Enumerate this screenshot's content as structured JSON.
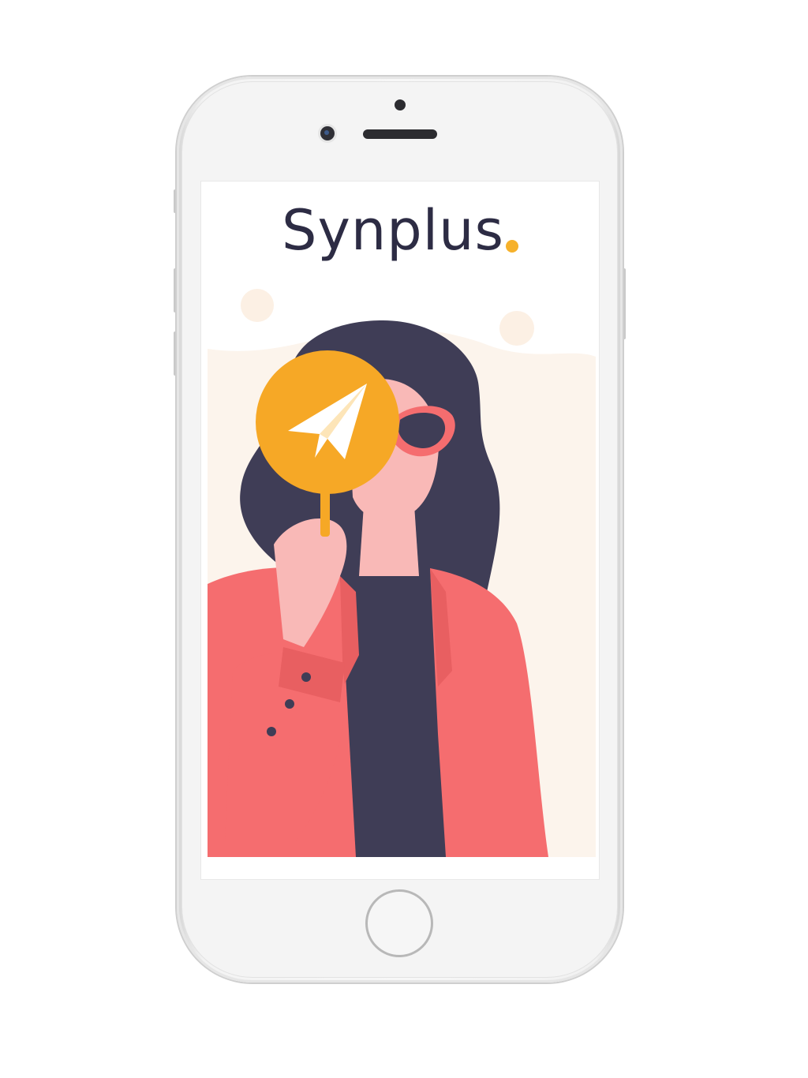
{
  "app": {
    "brand_name": "Synplus",
    "brand_dot_color": "#f6b12b",
    "brand_text_color": "#2d2c44"
  },
  "illustration": {
    "subject": "woman-holding-sign",
    "sign_icon": "paper-plane-icon",
    "colors": {
      "sign": "#f6a826",
      "jacket": "#f56d6f",
      "hair": "#3f3d56",
      "skin": "#f9b9b7",
      "background_blob": "#fcf4ec"
    }
  },
  "device": {
    "type": "smartphone",
    "frame_color": "#f4f4f4"
  }
}
